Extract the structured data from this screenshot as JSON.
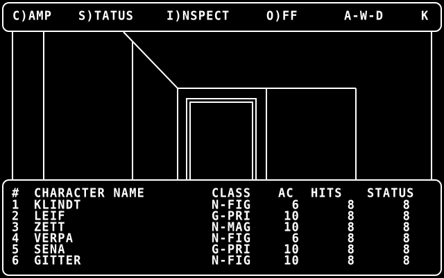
{
  "menu": {
    "camp": "C)AMP",
    "status": "S)TATUS",
    "inspect": "I)NSPECT",
    "off": "O)FF",
    "keys": "A-W-D",
    "turn": "K"
  },
  "party": {
    "headers": {
      "num": "#",
      "name": "CHARACTER NAME",
      "class": "CLASS",
      "ac": "AC",
      "hits": "HITS",
      "status": "STATUS"
    },
    "rows": [
      {
        "num": "1",
        "name": "KLINDT",
        "class": "N-FIG",
        "ac": "6",
        "hits": "8",
        "status": "8"
      },
      {
        "num": "2",
        "name": "LEIF",
        "class": "G-PRI",
        "ac": "10",
        "hits": "8",
        "status": "8"
      },
      {
        "num": "3",
        "name": "ZETT",
        "class": "N-MAG",
        "ac": "10",
        "hits": "8",
        "status": "8"
      },
      {
        "num": "4",
        "name": "VERPA",
        "class": "N-FIG",
        "ac": "6",
        "hits": "8",
        "status": "8"
      },
      {
        "num": "5",
        "name": "SENA",
        "class": "G-PRI",
        "ac": "10",
        "hits": "8",
        "status": "8"
      },
      {
        "num": "6",
        "name": "GITTER",
        "class": "N-FIG",
        "ac": "10",
        "hits": "8",
        "status": "8"
      }
    ]
  },
  "colors": {
    "background": "#000000",
    "foreground": "#ffffff"
  }
}
